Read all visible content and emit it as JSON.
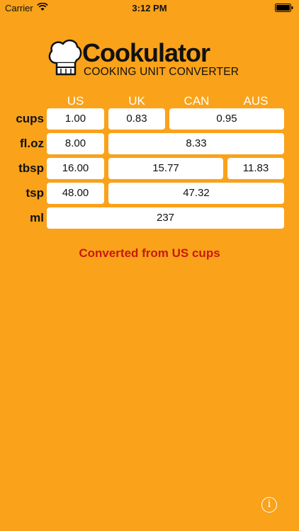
{
  "status_bar": {
    "carrier": "Carrier",
    "time": "3:12 PM"
  },
  "logo": {
    "title": "Cookulator",
    "subtitle": "COOKING UNIT CONVERTER"
  },
  "columns": [
    "US",
    "UK",
    "CAN",
    "AUS"
  ],
  "rows": {
    "cups": {
      "label": "cups",
      "us": "1.00",
      "uk": "0.83",
      "can_aus": "0.95"
    },
    "floz": {
      "label": "fl.oz",
      "us": "8.00",
      "uk_can_aus": "8.33"
    },
    "tbsp": {
      "label": "tbsp",
      "us": "16.00",
      "uk_can": "15.77",
      "aus": "11.83"
    },
    "tsp": {
      "label": "tsp",
      "us": "48.00",
      "uk_can_aus": "47.32"
    },
    "ml": {
      "label": "ml",
      "all": "237"
    }
  },
  "status_message": "Converted from US cups",
  "info_button": "i",
  "icons": [
    "wifi-icon",
    "battery-icon",
    "chef-hat-icon"
  ]
}
